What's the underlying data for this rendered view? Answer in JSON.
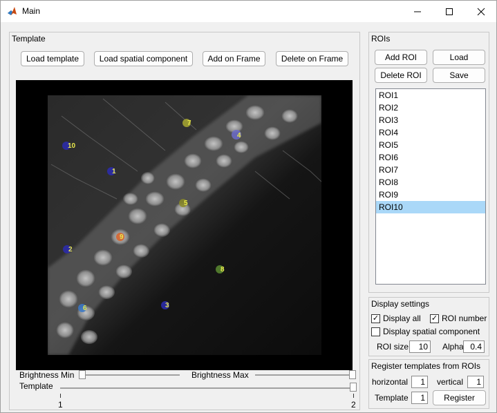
{
  "window": {
    "title": "Main",
    "minimize": "—",
    "maximize": "☐",
    "close": "✕"
  },
  "template_panel": {
    "title": "Template",
    "buttons": {
      "load_template": "Load template",
      "load_spatial": "Load spatial component",
      "add_frame": "Add on Frame",
      "delete_frame": "Delete on Frame"
    },
    "brightness_min_label": "Brightness Min",
    "brightness_max_label": "Brightness Max",
    "template_label": "Template",
    "template_slider": {
      "min": "1",
      "max": "2",
      "value": 2
    },
    "brightness_min_value": 0,
    "brightness_max_value": 1
  },
  "roi_markers": [
    {
      "label": "1",
      "color": "#2b2bb0"
    },
    {
      "label": "2",
      "color": "#2b2bb0"
    },
    {
      "label": "3",
      "color": "#2b2bb0"
    },
    {
      "label": "4",
      "color": "#6b6bc8"
    },
    {
      "label": "5",
      "color": "#8a8a28"
    },
    {
      "label": "6",
      "color": "#3a78c8"
    },
    {
      "label": "7",
      "color": "#a8a830"
    },
    {
      "label": "8",
      "color": "#5a8a30"
    },
    {
      "label": "9",
      "color": "#d86028"
    },
    {
      "label": "10",
      "color": "#2b2bb0"
    }
  ],
  "rois_panel": {
    "title": "ROIs",
    "buttons": {
      "add_roi": "Add ROI",
      "load": "Load",
      "delete_roi": "Delete ROI",
      "save": "Save"
    },
    "items": [
      "ROI1",
      "ROI2",
      "ROI3",
      "ROI4",
      "ROI5",
      "ROI6",
      "ROI7",
      "ROI8",
      "ROI9",
      "ROI10"
    ],
    "selected": "ROI10"
  },
  "display_settings": {
    "title": "Display settings",
    "display_all": {
      "label": "Display all",
      "checked": true
    },
    "roi_number": {
      "label": "ROI number",
      "checked": true
    },
    "display_spatial": {
      "label": "Display spatial component",
      "checked": false
    },
    "roi_size_label": "ROI size",
    "roi_size": "10",
    "alpha_label": "Alpha",
    "alpha": "0.4"
  },
  "register_panel": {
    "title": "Register templates from ROIs",
    "horizontal_label": "horizontal",
    "horizontal": "1",
    "vertical_label": "vertical",
    "vertical": "1",
    "template_label": "Template",
    "template": "1",
    "register_button": "Register"
  },
  "colors": {
    "selection": "#aad8f8",
    "roi_label": "#e8e84c"
  }
}
